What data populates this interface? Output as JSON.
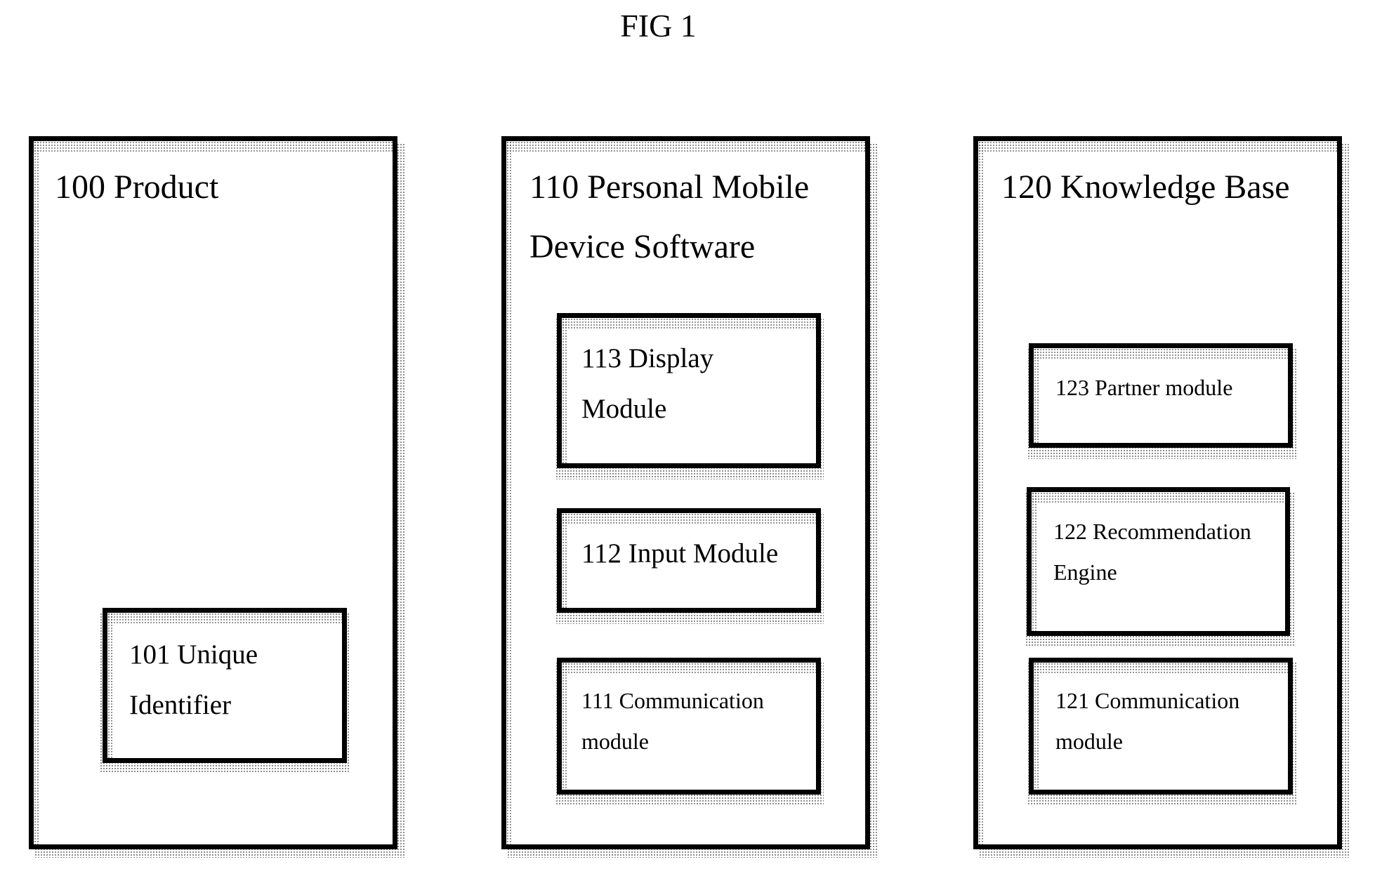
{
  "figure": {
    "title": "FIG 1"
  },
  "blocks": {
    "product": {
      "title": "100 Product",
      "children": {
        "unique_identifier": {
          "line1": "101 Unique",
          "line2": "Identifier"
        }
      }
    },
    "mobile_software": {
      "line1": "110 Personal Mobile",
      "line2": "Device Software",
      "children": {
        "display_module": {
          "line1": "113 Display",
          "line2": "Module"
        },
        "input_module": {
          "line1": "112 Input Module"
        },
        "communication_module": {
          "line1": "111 Communication",
          "line2": "module"
        }
      }
    },
    "knowledge_base": {
      "title": "120 Knowledge Base",
      "children": {
        "partner_module": {
          "line1": "123 Partner module"
        },
        "recommendation_engine": {
          "line1": "122 Recommendation",
          "line2": "Engine"
        },
        "communication_module": {
          "line1": "121 Communication",
          "line2": "module"
        }
      }
    }
  }
}
